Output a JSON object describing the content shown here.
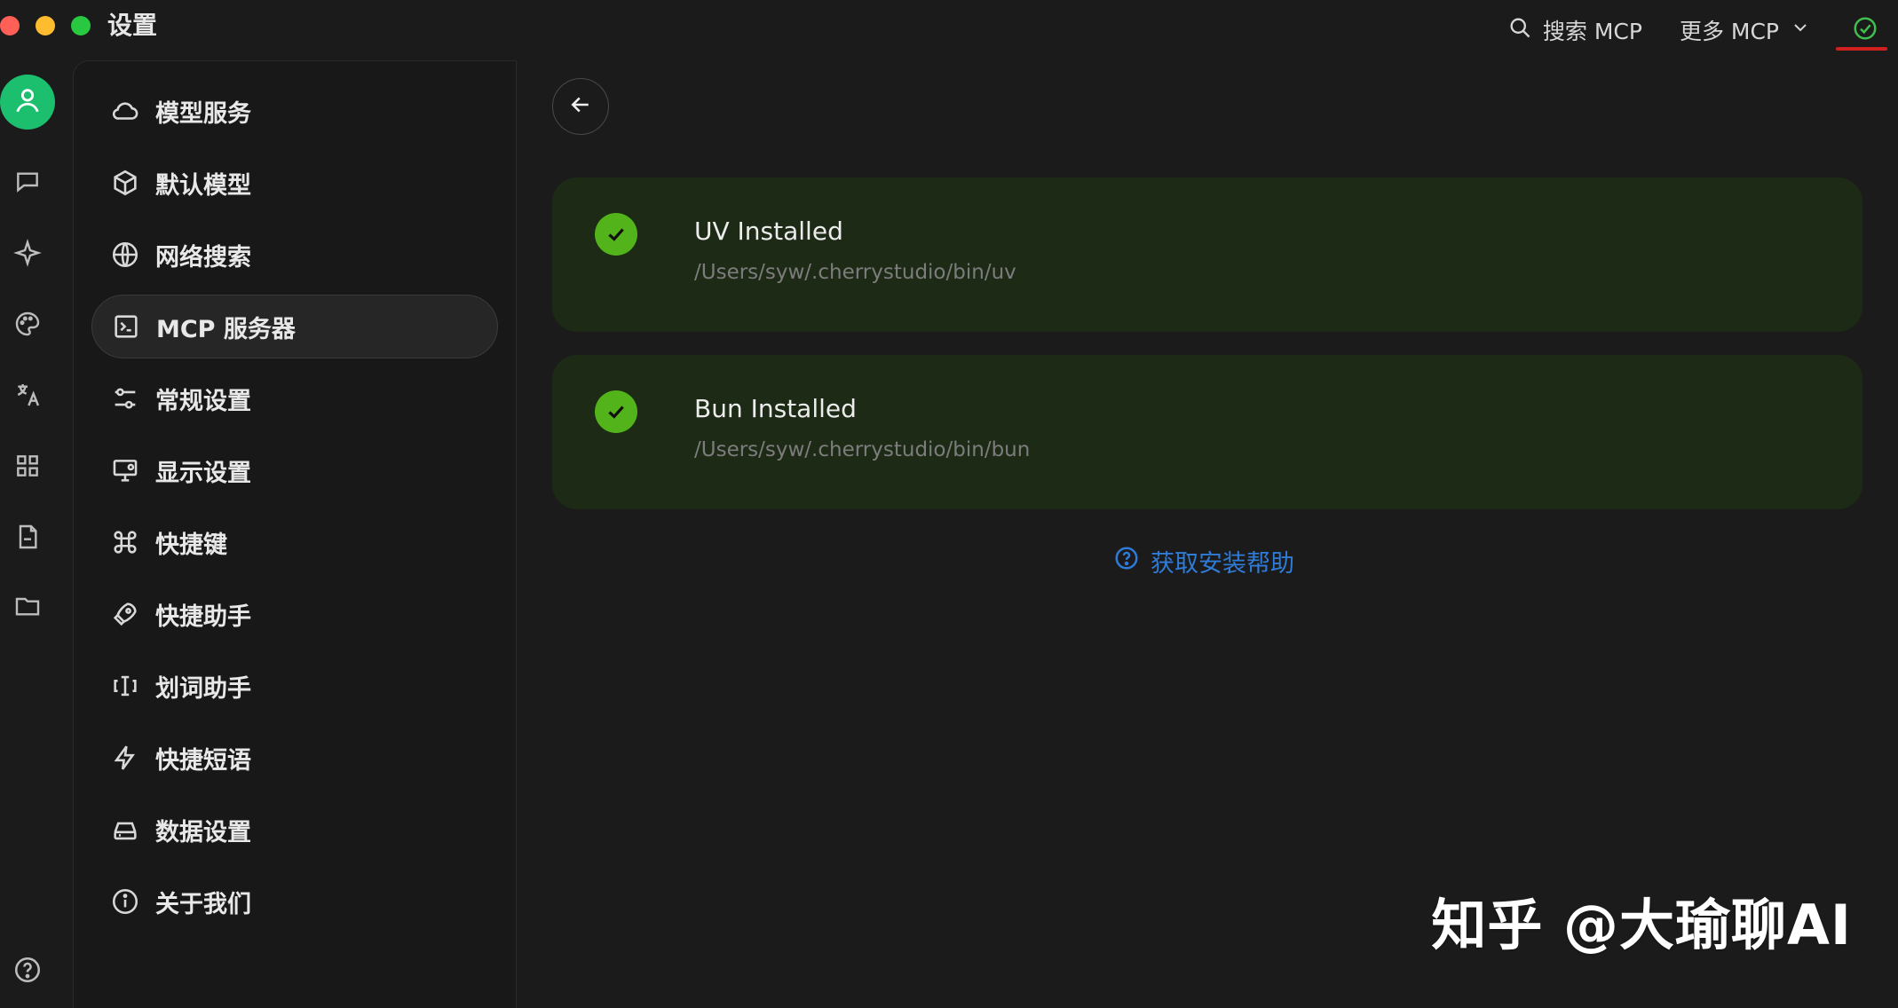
{
  "window": {
    "title": "设置"
  },
  "header": {
    "search_mcp_label": "搜索 MCP",
    "more_mcp_label": "更多 MCP",
    "status_icon": "check-circle-icon"
  },
  "rail": {
    "icons": [
      "user-icon",
      "chat-icon",
      "sparkle-icon",
      "palette-icon",
      "translate-icon",
      "apps-icon",
      "file-icon",
      "folder-icon",
      "help-icon"
    ]
  },
  "sidebar": {
    "items": [
      {
        "label": "模型服务",
        "icon": "cloud-icon"
      },
      {
        "label": "默认模型",
        "icon": "cube-icon"
      },
      {
        "label": "网络搜索",
        "icon": "globe-icon"
      },
      {
        "label": "MCP 服务器",
        "icon": "terminal-icon",
        "active": true
      },
      {
        "label": "常规设置",
        "icon": "sliders-icon"
      },
      {
        "label": "显示设置",
        "icon": "monitor-settings-icon"
      },
      {
        "label": "快捷键",
        "icon": "command-icon"
      },
      {
        "label": "快捷助手",
        "icon": "rocket-icon"
      },
      {
        "label": "划词助手",
        "icon": "text-select-icon"
      },
      {
        "label": "快捷短语",
        "icon": "lightning-icon"
      },
      {
        "label": "数据设置",
        "icon": "drive-icon"
      },
      {
        "label": "关于我们",
        "icon": "info-icon"
      }
    ]
  },
  "content": {
    "cards": [
      {
        "title": "UV Installed",
        "path": "/Users/syw/.cherrystudio/bin/uv"
      },
      {
        "title": "Bun Installed",
        "path": "/Users/syw/.cherrystudio/bin/bun"
      }
    ],
    "help_link": "获取安装帮助"
  },
  "watermark": {
    "text": "知乎 @大瑜聊AI"
  },
  "colors": {
    "accent_green": "#52b31a",
    "rail_avatar_green": "#1bbf6d",
    "link_blue": "#2f7bd8",
    "card_bg": "#1d2a16"
  }
}
